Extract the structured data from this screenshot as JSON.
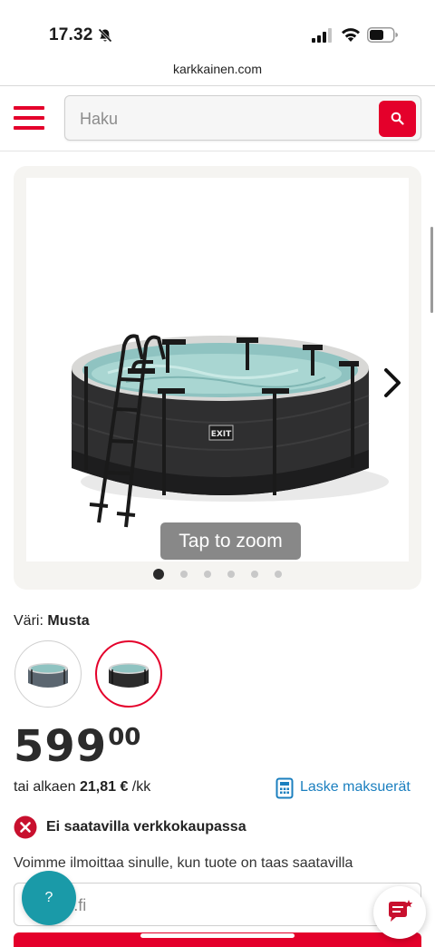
{
  "status_bar": {
    "time": "17.32",
    "icons": [
      "bell-off-icon",
      "signal-icon",
      "wifi-icon",
      "battery-icon"
    ]
  },
  "browser": {
    "url": "karkkainen.com"
  },
  "header": {
    "menu_icon": "hamburger-menu-icon",
    "search": {
      "placeholder": "Haku",
      "button_icon": "search-icon"
    }
  },
  "gallery": {
    "image_alt": "round black frame pool with ladder",
    "tap_to_zoom": "Tap to zoom",
    "next_icon": "chevron-right-icon",
    "total_images": 6,
    "active_index": 0
  },
  "product": {
    "color_label": "Väri:",
    "color_value": "Musta",
    "swatches": [
      {
        "name": "grey-pool-swatch",
        "selected": false
      },
      {
        "name": "black-pool-swatch",
        "selected": true
      }
    ],
    "price_main": "599",
    "price_cents": "00",
    "installment_prefix": "tai alkaen",
    "installment_amount": "21,81 €",
    "installment_suffix": "/kk",
    "calculator_label": "Laske maksuerät",
    "availability": "Ei saatavilla verkkokaupassa",
    "notify_text": "Voimme ilmoittaa sinulle, kun tuote on taas saatavilla",
    "email_placeholder": "@mail.fi"
  },
  "floating": {
    "help_label": "?",
    "chat_icon": "chat-icon"
  },
  "colors": {
    "brand_red": "#e4002b",
    "link_blue": "#1b7fbf",
    "help_teal": "#1a9aa8",
    "text_dark": "#1c1c1c"
  }
}
